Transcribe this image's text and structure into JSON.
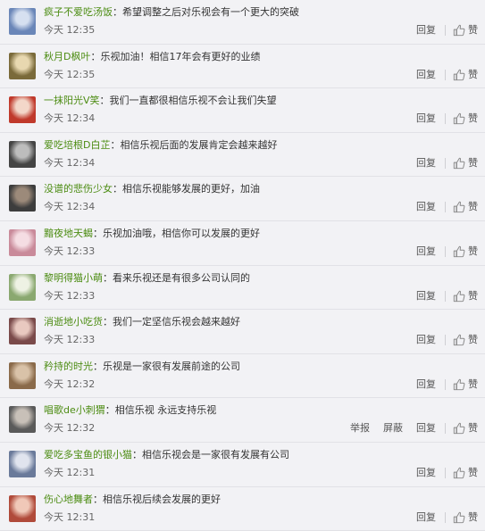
{
  "comments": [
    {
      "username": "疯子不爱吃汤饭",
      "colon": "：",
      "message": "希望调整之后对乐视会有一个更大的突破",
      "time": "今天 12:35",
      "reply_label": "回复",
      "like_label": "赞",
      "avatar_colors": [
        "#6a86b8",
        "#d6e0f0"
      ]
    },
    {
      "username": "秋月D枫叶",
      "colon": "：",
      "message": "乐视加油！相信17年会有更好的业绩",
      "time": "今天 12:35",
      "reply_label": "回复",
      "like_label": "赞",
      "avatar_colors": [
        "#7a6a3a",
        "#e8d8b0"
      ]
    },
    {
      "username": "一抹阳光V笑",
      "colon": "：",
      "message": "我们一直都很相信乐视不会让我们失望",
      "time": "今天 12:34",
      "reply_label": "回复",
      "like_label": "赞",
      "avatar_colors": [
        "#c0392b",
        "#f3d7c9"
      ]
    },
    {
      "username": "爱吃培根D白芷",
      "colon": "：",
      "message": "相信乐视后面的发展肯定会越来越好",
      "time": "今天 12:34",
      "reply_label": "回复",
      "like_label": "赞",
      "avatar_colors": [
        "#444444",
        "#bdbdbd"
      ]
    },
    {
      "username": "没谱的悲伤少女",
      "colon": "：",
      "message": "相信乐视能够发展的更好，加油",
      "time": "今天 12:34",
      "reply_label": "回复",
      "like_label": "赞",
      "avatar_colors": [
        "#3d3d3d",
        "#9c8a7a"
      ]
    },
    {
      "username": "黯夜地天蝎",
      "colon": "：",
      "message": "乐视加油哦，相信你可以发展的更好",
      "time": "今天 12:33",
      "reply_label": "回复",
      "like_label": "赞",
      "avatar_colors": [
        "#c98a9a",
        "#f5dde3"
      ]
    },
    {
      "username": "黎明得猫小萌",
      "colon": "：",
      "message": "看来乐视还是有很多公司认同的",
      "time": "今天 12:33",
      "reply_label": "回复",
      "like_label": "赞",
      "avatar_colors": [
        "#8aa870",
        "#eef2e4"
      ]
    },
    {
      "username": "消逝地小吃货",
      "colon": "：",
      "message": "我们一定坚信乐视会越来越好",
      "time": "今天 12:33",
      "reply_label": "回复",
      "like_label": "赞",
      "avatar_colors": [
        "#7a4a4a",
        "#e9c9c0"
      ]
    },
    {
      "username": "矜持的时光",
      "colon": "：",
      "message": "乐视是一家很有发展前途的公司",
      "time": "今天 12:32",
      "reply_label": "回复",
      "like_label": "赞",
      "avatar_colors": [
        "#8a6a4a",
        "#d9c2a8"
      ]
    },
    {
      "username": "唱歌de小刺猬",
      "colon": "：",
      "message": "相信乐视 永远支持乐视",
      "time": "今天 12:32",
      "report_label": "举报",
      "block_label": "屏蔽",
      "reply_label": "回复",
      "like_label": "赞",
      "avatar_colors": [
        "#5a5a5a",
        "#c8c0b8"
      ]
    },
    {
      "username": "爱吃多宝鱼的银小猫",
      "colon": "：",
      "message": "相信乐视会是一家很有发展有公司",
      "time": "今天 12:31",
      "reply_label": "回复",
      "like_label": "赞",
      "avatar_colors": [
        "#6a7a9a",
        "#e0e4ee"
      ]
    },
    {
      "username": "伤心地舞者",
      "colon": "：",
      "message": "相信乐视后续会发展的更好",
      "time": "今天 12:31",
      "reply_label": "回复",
      "like_label": "赞",
      "avatar_colors": [
        "#b04a3a",
        "#f0c8b8"
      ]
    }
  ],
  "colors": {
    "username": "#4c8c12",
    "background": "#f2f2f5",
    "divider": "#e1e1e6"
  }
}
